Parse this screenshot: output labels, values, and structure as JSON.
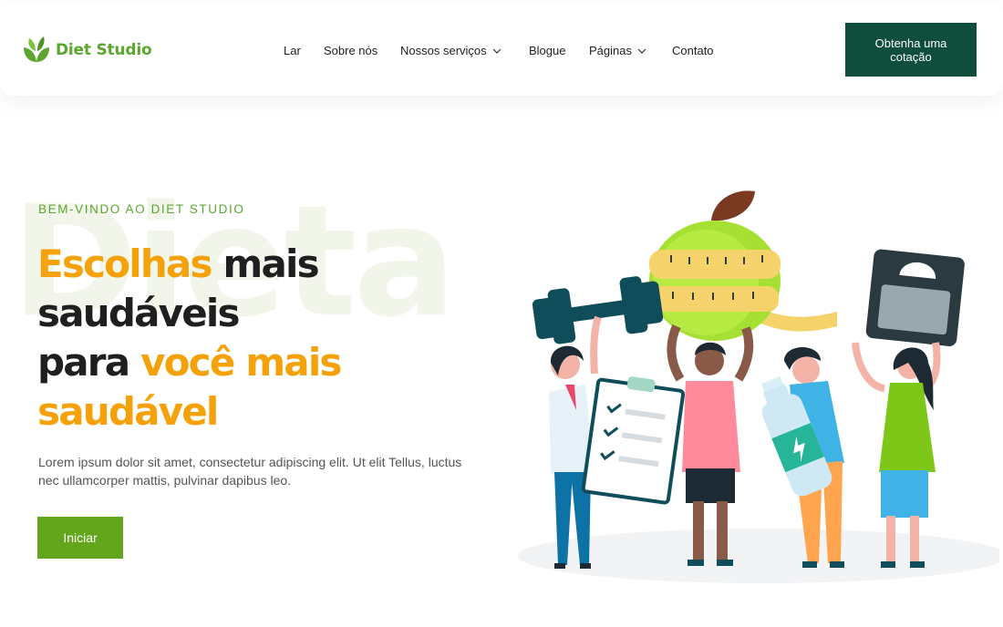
{
  "brand": {
    "name": "Diet Studio",
    "color": "#5aa62e",
    "icon": "leaf-logo-icon"
  },
  "nav": {
    "items": [
      {
        "label": "Lar",
        "has_dropdown": false
      },
      {
        "label": "Sobre nós",
        "has_dropdown": false
      },
      {
        "label": "Nossos serviços",
        "has_dropdown": true
      },
      {
        "label": "Blogue",
        "has_dropdown": false
      },
      {
        "label": "Páginas",
        "has_dropdown": true
      },
      {
        "label": "Contato",
        "has_dropdown": false
      }
    ],
    "dropdown_icon": "chevron-down-icon"
  },
  "header": {
    "cta_line1": "Obtenha uma",
    "cta_line2": "cotação",
    "cta_color": "#0f4d3d"
  },
  "hero": {
    "watermark": "Dieta",
    "eyebrow": "BEM-VINDO AO DIET STUDIO",
    "headline": {
      "part1": "Escolhas",
      "part2": " mais",
      "part3": "saudáveis",
      "part4": "para ",
      "part5": "você mais",
      "part6": "saudável"
    },
    "description": "Lorem ipsum dolor sit amet, consectetur adipiscing elit. Ut elit Tellus, luctus nec ullamcorper mattis, pulvinar dapibus leo.",
    "button_label": "Iniciar",
    "colors": {
      "accent": "#f5a10a",
      "green": "#63a61b",
      "text": "#1f1f1f"
    }
  }
}
